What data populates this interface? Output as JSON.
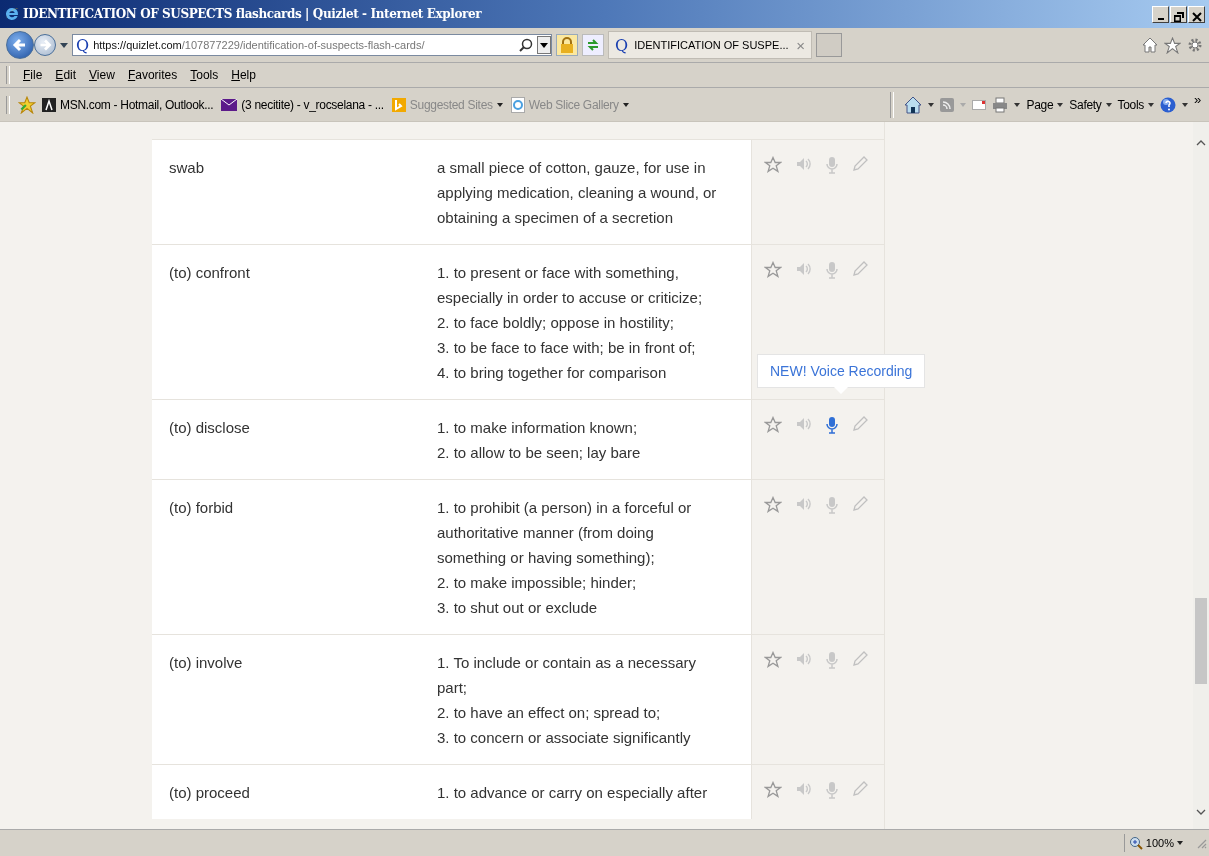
{
  "window": {
    "title": "IDENTIFICATION OF SUSPECTS flashcards | Quizlet - Internet Explorer"
  },
  "address_bar": {
    "site_icon": "Q",
    "url_host": "https://quizlet.com",
    "url_path": "/107877229/identification-of-suspects-flash-cards/"
  },
  "tab": {
    "icon": "Q",
    "title": "IDENTIFICATION OF SUSPE...",
    "close": "×"
  },
  "menu": [
    "File",
    "Edit",
    "View",
    "Favorites",
    "Tools",
    "Help"
  ],
  "favorites": [
    {
      "label": "MSN.com - Hotmail, Outlook...",
      "kind": "msn",
      "dimmed": false,
      "dropdown": false
    },
    {
      "label": "(3 necitite) - v_rocselana - ...",
      "kind": "mail",
      "dimmed": false,
      "dropdown": false
    },
    {
      "label": "Suggested Sites",
      "kind": "bing",
      "dimmed": true,
      "dropdown": true
    },
    {
      "label": "Web Slice Gallery",
      "kind": "ie",
      "dimmed": true,
      "dropdown": true
    }
  ],
  "command_bar": {
    "menus": [
      "Page",
      "Safety",
      "Tools"
    ],
    "more": "»"
  },
  "tooltip": "NEW! Voice Recording",
  "cards": [
    {
      "term": "swab",
      "definition": [
        "a small piece of cotton, gauze, for use in",
        "applying medication, cleaning a wound, or",
        "obtaining a specimen of a secretion"
      ],
      "mic_active": false
    },
    {
      "term": "(to) confront",
      "definition": [
        "1. to present or face with something,",
        "especially in order to accuse or criticize;",
        "2. to face boldly; oppose in hostility;",
        "3. to be face to face with; be in front of;",
        "4. to bring together for comparison"
      ],
      "mic_active": false
    },
    {
      "term": "(to) disclose",
      "definition": [
        "1. to make information known;",
        "2. to allow to be seen; lay bare"
      ],
      "mic_active": true
    },
    {
      "term": "(to) forbid",
      "definition": [
        "1. to prohibit (a person) in a forceful or",
        "authoritative manner (from doing",
        "something or having something);",
        "2. to make impossible; hinder;",
        "3. to shut out or exclude"
      ],
      "mic_active": false
    },
    {
      "term": "(to) involve",
      "definition": [
        "1. To include or contain as a necessary",
        "part;",
        "2. to have an effect on; spread to;",
        "3. to concern or associate significantly"
      ],
      "mic_active": false
    },
    {
      "term": "(to) proceed",
      "definition": [
        "1. to advance or carry on especially after"
      ],
      "mic_active": false
    }
  ],
  "status_bar": {
    "zoom": "100%"
  }
}
